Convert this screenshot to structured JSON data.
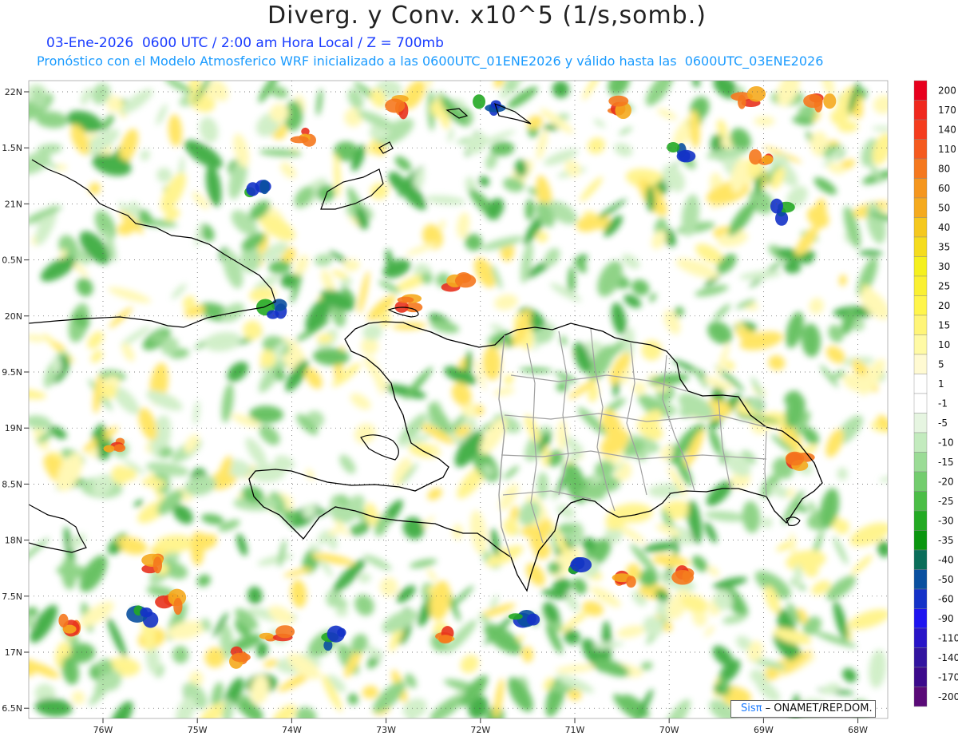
{
  "header": {
    "title": "Diverg. y Conv. x10^5 (1/s,somb.)",
    "subtitle_time": "03-Ene-2026  0600 UTC / 2:00 am Hora Local / Z = 700mb",
    "subtitle_model": "Pronóstico con el Modelo Atmosferico WRF inicializado a las 0600UTC_01ENE2026 y válido hasta las  0600UTC_03ENE2026"
  },
  "map": {
    "lat_labels": [
      "22N",
      "1.5N",
      "21N",
      "0.5N",
      "20N",
      "9.5N",
      "19N",
      "8.5N",
      "18N",
      "7.5N",
      "17N",
      "6.5N"
    ],
    "lon_labels": [
      "76W",
      "75W",
      "74W",
      "73W",
      "72W",
      "71W",
      "70W",
      "69W",
      "68W"
    ],
    "field": "divergence_convergence_700mb",
    "colors": {
      "coast": "#000000",
      "provinces": "#a0a0a0"
    }
  },
  "colorbar": {
    "labels": [
      "200",
      "170",
      "140",
      "110",
      "80",
      "60",
      "50",
      "40",
      "35",
      "30",
      "25",
      "20",
      "15",
      "10",
      "5",
      "1",
      "-1",
      "-5",
      "-10",
      "-15",
      "-20",
      "-25",
      "-30",
      "-35",
      "-40",
      "-50",
      "-60",
      "-90",
      "-110",
      "-140",
      "-170",
      "-200"
    ],
    "colors": [
      "#e8001e",
      "#f0281e",
      "#f53c1e",
      "#f55a1e",
      "#f5781e",
      "#f5961e",
      "#f5aa1e",
      "#f5c81e",
      "#f5dc1e",
      "#f5f01e",
      "#faf032",
      "#fff54b",
      "#fff578",
      "#fffaa5",
      "#fffad2",
      "#ffffff",
      "#ffffff",
      "#e6f5e1",
      "#c3ebbe",
      "#9bdc96",
      "#73cd6e",
      "#4bbe46",
      "#23aa23",
      "#0a960f",
      "#0a6e5a",
      "#0a50a0",
      "#1432c8",
      "#1e14f0",
      "#2814c8",
      "#3214a0",
      "#3c0a8c",
      "#5a0a78"
    ]
  },
  "credit": {
    "brand": "Sisπ",
    "org": " – ONAMET/REP.DOM."
  }
}
